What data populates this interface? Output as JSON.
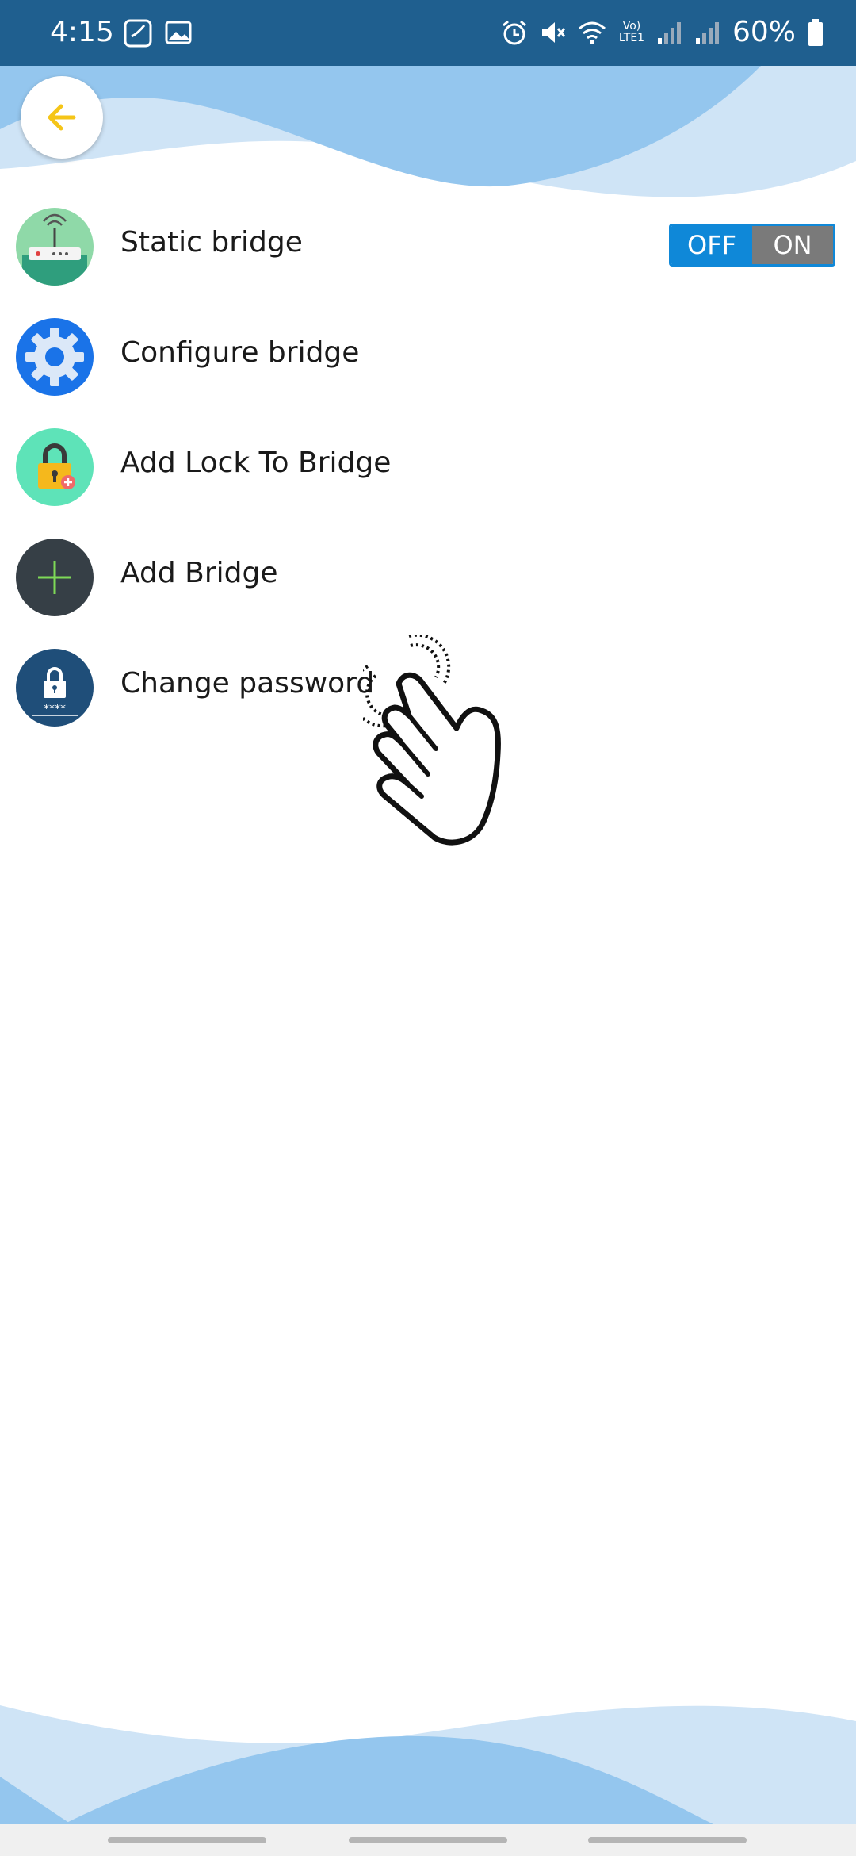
{
  "status_bar": {
    "time": "4:15",
    "battery": "60%",
    "network_label": "Vo) LTE1",
    "icons": [
      "saavn-icon",
      "gallery-icon",
      "alarm-icon",
      "mute-icon",
      "wifi-icon",
      "signal-icon",
      "battery-icon"
    ]
  },
  "menu": {
    "items": [
      {
        "label": "Static bridge",
        "icon": "router-icon"
      },
      {
        "label": "Configure bridge",
        "icon": "gear-icon"
      },
      {
        "label": "Add Lock To Bridge",
        "icon": "lock-plus-icon"
      },
      {
        "label": "Add Bridge",
        "icon": "plus-icon"
      },
      {
        "label": "Change password",
        "icon": "password-lock-icon"
      }
    ]
  },
  "toggle": {
    "off_label": "OFF",
    "on_label": "ON",
    "state": "off"
  },
  "colors": {
    "status_bar": "#1f5f8f",
    "accent_blue": "#0f88d8",
    "back_arrow": "#f5c518",
    "wave_light": "#cfe4f6",
    "wave_mid": "#94c6ee"
  }
}
